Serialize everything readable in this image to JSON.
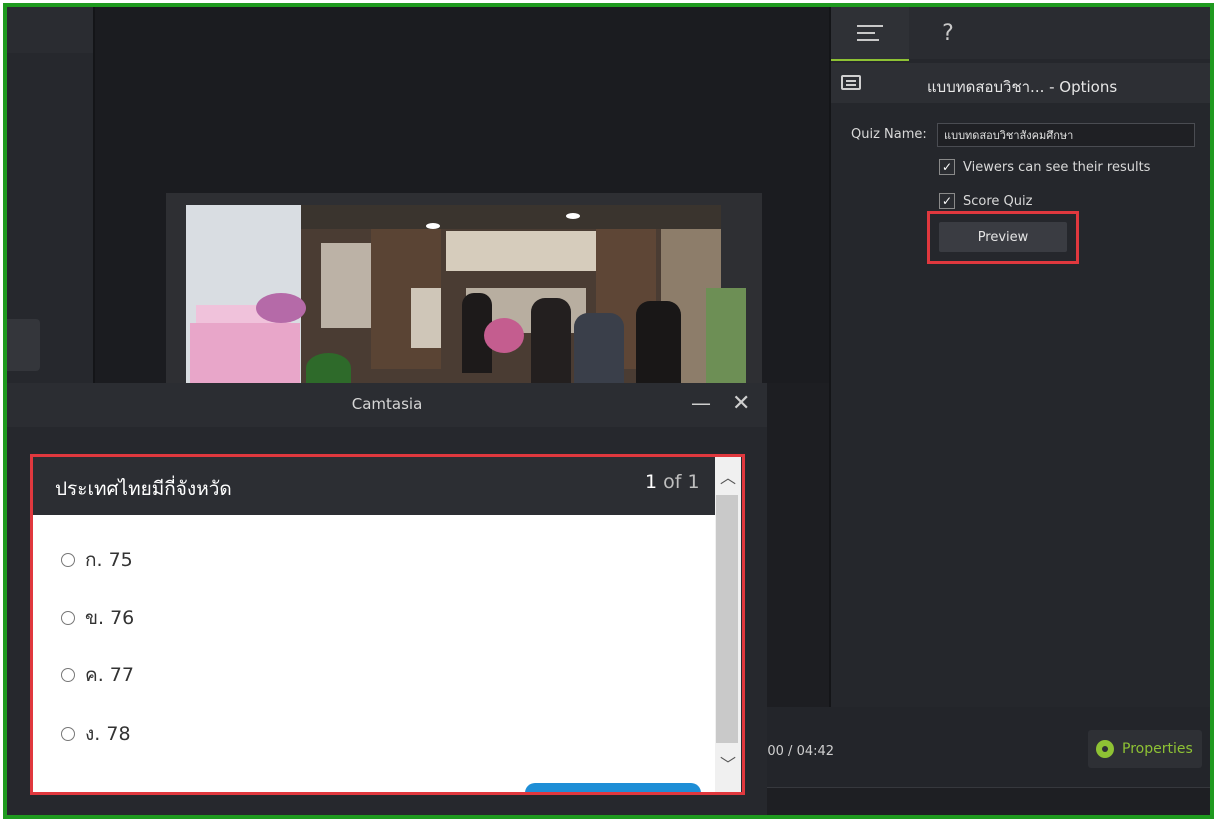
{
  "right_panel": {
    "tabs": [
      {
        "icon": "menu-icon"
      },
      {
        "label": "?"
      }
    ],
    "options_title": "แบบทดสอบวิชา... - Options",
    "quiz_name_label": "Quiz Name:",
    "quiz_name_value": "แบบทดสอบวิชาสังคมศึกษา",
    "viewers_see_results": {
      "label": "Viewers can see their results",
      "checked": true
    },
    "score_quiz": {
      "label": "Score Quiz",
      "checked": true
    },
    "preview_button": "Preview",
    "check_mark": "✓"
  },
  "timeline": {
    "time": ":00  /  04:42",
    "properties_button": "Properties"
  },
  "camtasia_window": {
    "title": "Camtasia",
    "minimize": "—",
    "close": "✕",
    "quiz": {
      "question": "ประเทศไทยมีกี่จังหวัด",
      "count_current": "1",
      "count_rest": " of 1",
      "answers": [
        "ก. 75",
        "ข. 76",
        "ค. 77",
        "ง. 78"
      ],
      "scroll_up": "︿",
      "scroll_down": "﹀"
    }
  },
  "colors": {
    "frame_border": "#1f9a1f",
    "accent_green": "#8ec234",
    "highlight_red": "#e0383e",
    "submit_blue": "#1e8ed6"
  }
}
